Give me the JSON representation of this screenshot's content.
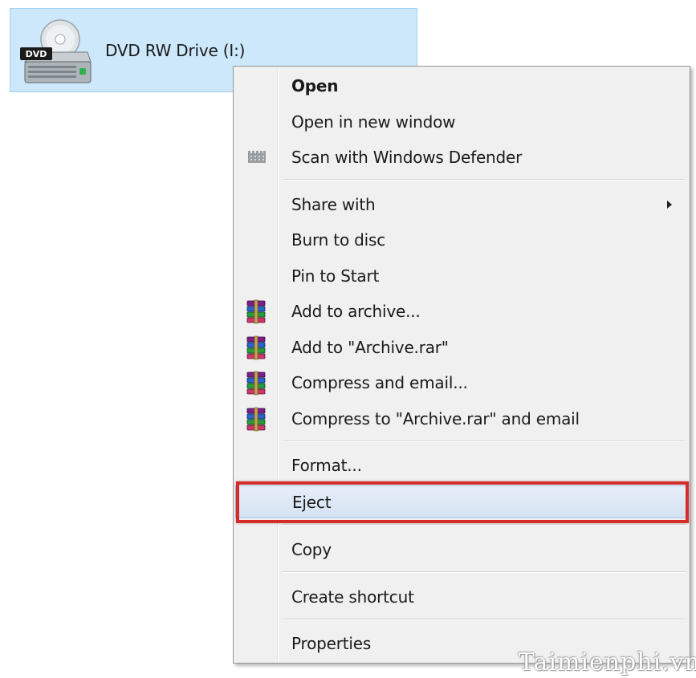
{
  "window": {
    "drive_label": "DVD RW Drive (I:)",
    "drive_icon": "dvd-drive-icon",
    "drive_badge": "DVD"
  },
  "context_menu": {
    "items": [
      {
        "label": "Open",
        "bold": true,
        "icon": null
      },
      {
        "label": "Open in new window",
        "icon": null
      },
      {
        "label": "Scan with Windows Defender",
        "icon": "windows-defender-icon"
      },
      {
        "label": "Share with",
        "icon": null,
        "submenu": true
      },
      {
        "label": "Burn to disc",
        "icon": null
      },
      {
        "label": "Pin to Start",
        "icon": null
      },
      {
        "label": "Add to archive...",
        "icon": "winrar-icon"
      },
      {
        "label": "Add to \"Archive.rar\"",
        "icon": "winrar-icon"
      },
      {
        "label": "Compress and email...",
        "icon": "winrar-icon"
      },
      {
        "label": "Compress to \"Archive.rar\" and email",
        "icon": "winrar-icon"
      },
      {
        "label": "Format...",
        "icon": null
      },
      {
        "label": "Eject",
        "icon": null,
        "hovered": true,
        "highlighted": true
      },
      {
        "label": "Copy",
        "icon": null
      },
      {
        "label": "Create shortcut",
        "icon": null
      },
      {
        "label": "Properties",
        "icon": null
      }
    ]
  },
  "annotation": {
    "highlight_color": "#d42b2b"
  },
  "watermark": {
    "text": "Taimienphi.vn"
  },
  "colors": {
    "selection_bg": "#cde8fb",
    "selection_border": "#9fd1f3",
    "menu_bg": "#f0f0f0",
    "hover_bg": "#dce7f5"
  }
}
